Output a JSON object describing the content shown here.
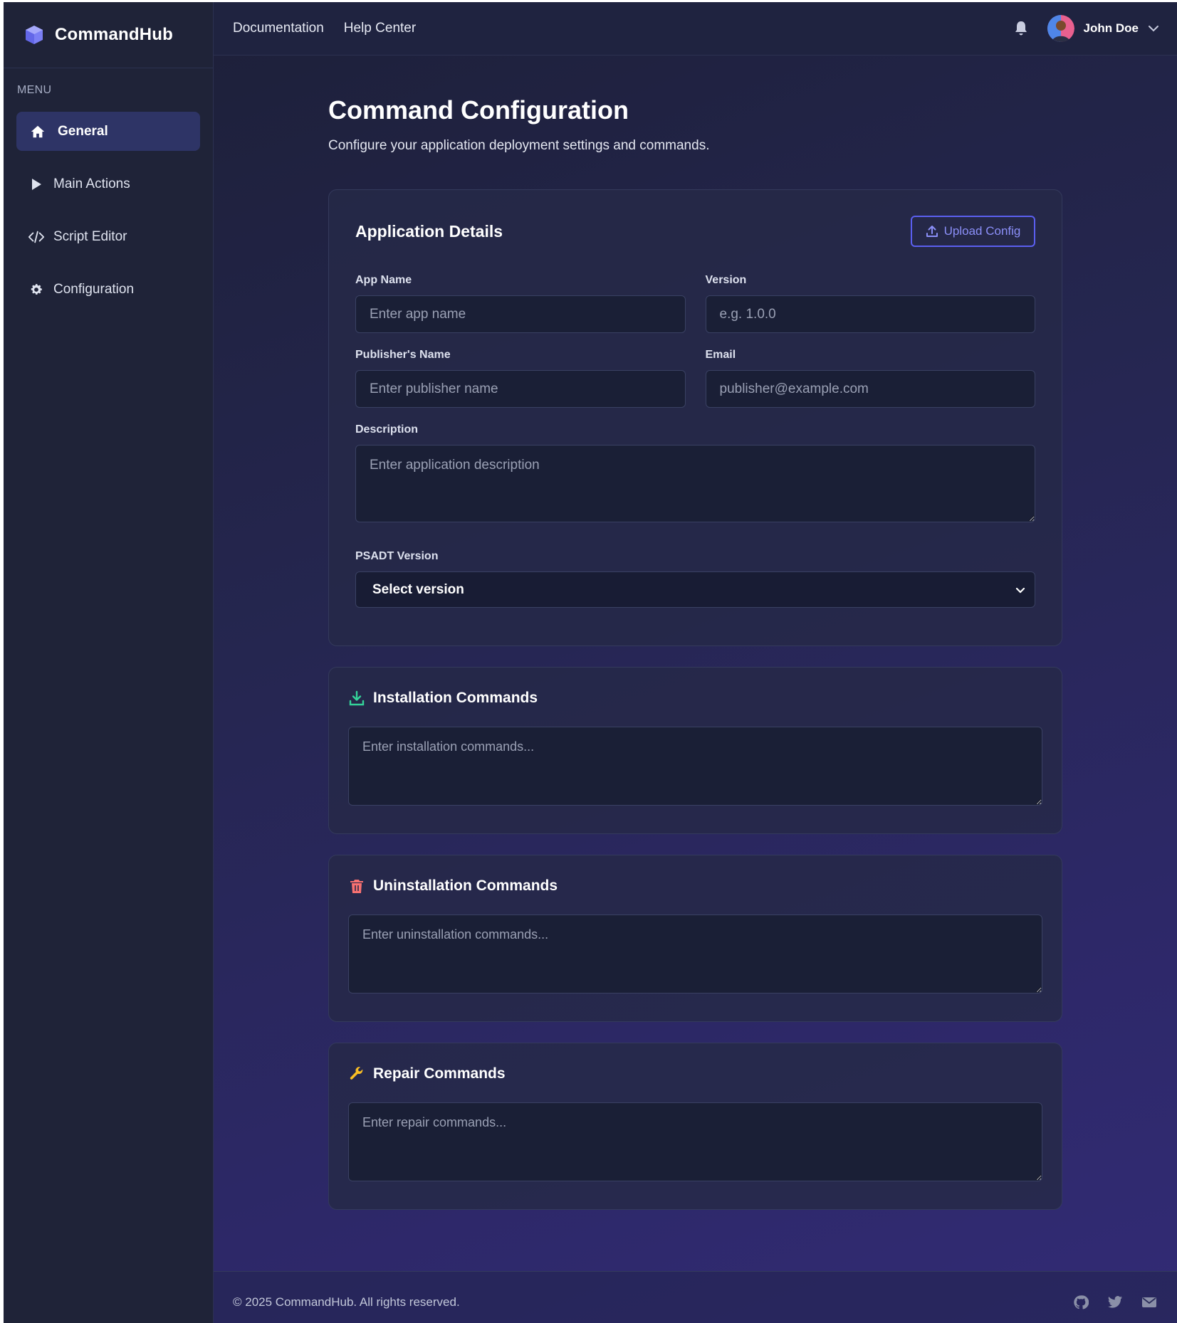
{
  "brand": {
    "name": "CommandHub"
  },
  "sidebar": {
    "menu_label": "MENU",
    "items": [
      {
        "label": "General",
        "icon": "home-icon",
        "active": true
      },
      {
        "label": "Main Actions",
        "icon": "play-icon",
        "active": false
      },
      {
        "label": "Script Editor",
        "icon": "code-icon",
        "active": false
      },
      {
        "label": "Configuration",
        "icon": "gear-icon",
        "active": false
      }
    ]
  },
  "topbar": {
    "links": [
      "Documentation",
      "Help Center"
    ],
    "user_name": "John Doe"
  },
  "page": {
    "title": "Command Configuration",
    "subtitle": "Configure your application deployment settings and commands."
  },
  "details": {
    "title": "Application Details",
    "upload_label": "Upload Config",
    "app_name": {
      "label": "App Name",
      "placeholder": "Enter app name",
      "value": ""
    },
    "version": {
      "label": "Version",
      "placeholder": "e.g. 1.0.0",
      "value": ""
    },
    "publisher": {
      "label": "Publisher's Name",
      "placeholder": "Enter publisher name",
      "value": ""
    },
    "email": {
      "label": "Email",
      "placeholder": "publisher@example.com",
      "value": ""
    },
    "description": {
      "label": "Description",
      "placeholder": "Enter application description",
      "value": ""
    },
    "psadt": {
      "label": "PSADT Version",
      "selected": "Select version"
    }
  },
  "commands": {
    "install": {
      "title": "Installation Commands",
      "placeholder": "Enter installation commands...",
      "icon": "download-icon",
      "color": "#34d399"
    },
    "uninstall": {
      "title": "Uninstallation Commands",
      "placeholder": "Enter uninstallation commands...",
      "icon": "trash-icon",
      "color": "#f87171"
    },
    "repair": {
      "title": "Repair Commands",
      "placeholder": "Enter repair commands...",
      "icon": "wrench-icon",
      "color": "#fbbf24"
    }
  },
  "footer": {
    "copyright": "© 2025 CommandHub. All rights reserved.",
    "socials": [
      "github-icon",
      "twitter-icon",
      "mail-icon"
    ]
  },
  "colors": {
    "accent": "#5b5ff0",
    "sidebar_bg": "#1f2338",
    "active_nav": "#2e3466"
  }
}
